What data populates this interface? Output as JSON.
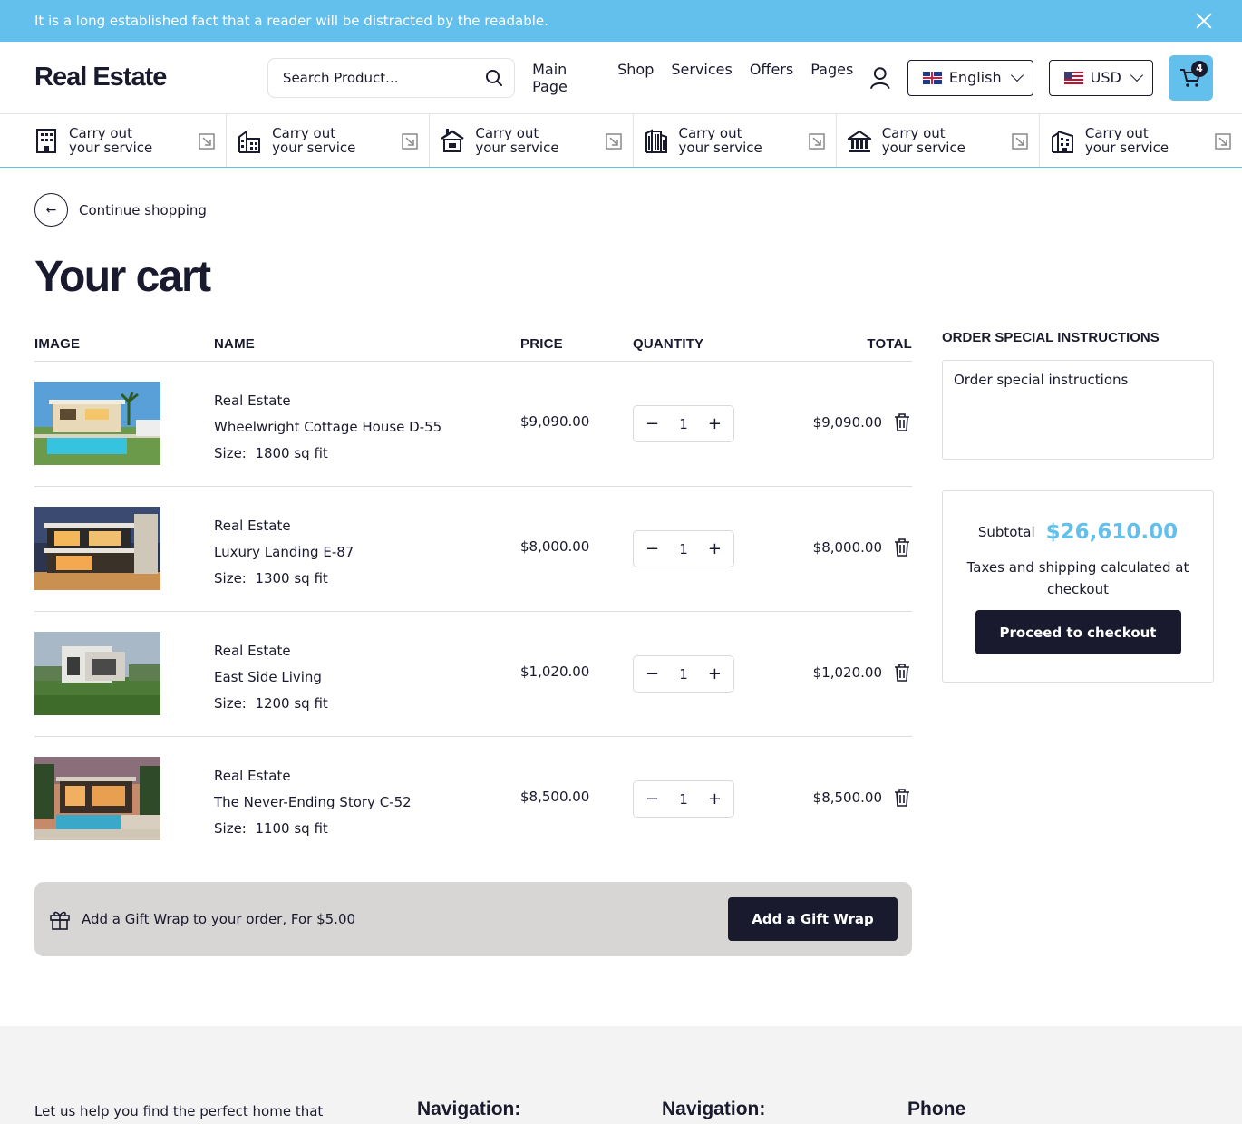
{
  "announcement": {
    "text": "It is a long established fact that a reader will be distracted by the readable."
  },
  "header": {
    "logo": "Real Estate",
    "search_placeholder": "Search Product...",
    "nav": [
      "Main Page",
      "Shop",
      "Services",
      "Offers",
      "Pages"
    ],
    "language": "English",
    "currency": "USD",
    "cart_count": "4"
  },
  "services": [
    {
      "line1": "Carry out",
      "line2": "your service",
      "icon": "office-building-icon"
    },
    {
      "line1": "Carry out",
      "line2": "your service",
      "icon": "buildings-icon"
    },
    {
      "line1": "Carry out",
      "line2": "your service",
      "icon": "house-icon"
    },
    {
      "line1": "Carry out",
      "line2": "your service",
      "icon": "skyscraper-icon"
    },
    {
      "line1": "Carry out",
      "line2": "your service",
      "icon": "bank-icon"
    },
    {
      "line1": "Carry out",
      "line2": "your service",
      "icon": "apartment-icon"
    }
  ],
  "continue_label": "Continue shopping",
  "page_title": "Your cart",
  "table": {
    "headers": {
      "image": "IMAGE",
      "name": "NAME",
      "price": "PRICE",
      "quantity": "QUANTITY",
      "total": "TOTAL"
    },
    "size_label": "Size:",
    "items": [
      {
        "category": "Real Estate",
        "name": "Wheelwright Cottage House D-55",
        "size": "1800 sq fit",
        "price": "$9,090.00",
        "qty": "1",
        "total": "$9,090.00",
        "image": "villa-with-pool"
      },
      {
        "category": "Real Estate",
        "name": "Luxury Landing E-87",
        "size": "1300 sq fit",
        "price": "$8,000.00",
        "qty": "1",
        "total": "$8,000.00",
        "image": "modern-house-sunset"
      },
      {
        "category": "Real Estate",
        "name": "East Side Living",
        "size": "1200 sq fit",
        "price": "$1,020.00",
        "qty": "1",
        "total": "$1,020.00",
        "image": "white-house-grass"
      },
      {
        "category": "Real Estate",
        "name": "The Never-Ending Story C-52",
        "size": "1100 sq fit",
        "price": "$8,500.00",
        "qty": "1",
        "total": "$8,500.00",
        "image": "house-pool-dusk"
      }
    ]
  },
  "gift": {
    "text": "Add a Gift Wrap to your order, For $5.00",
    "button": "Add a Gift Wrap"
  },
  "instructions": {
    "label": "ORDER SPECIAL INSTRUCTIONS",
    "placeholder": "Order special instructions"
  },
  "summary": {
    "subtotal_label": "Subtotal",
    "subtotal_value": "$26,610.00",
    "taxes": "Taxes and shipping calculated at checkout",
    "checkout": "Proceed to checkout"
  },
  "footer": {
    "text": "Let us help you find the perfect home that",
    "headings": [
      "Navigation:",
      "Navigation:",
      "Phone"
    ]
  },
  "colors": {
    "accent": "#63bfeb",
    "dark": "#1a1a2e",
    "gift_bg": "#d8d5d5"
  }
}
